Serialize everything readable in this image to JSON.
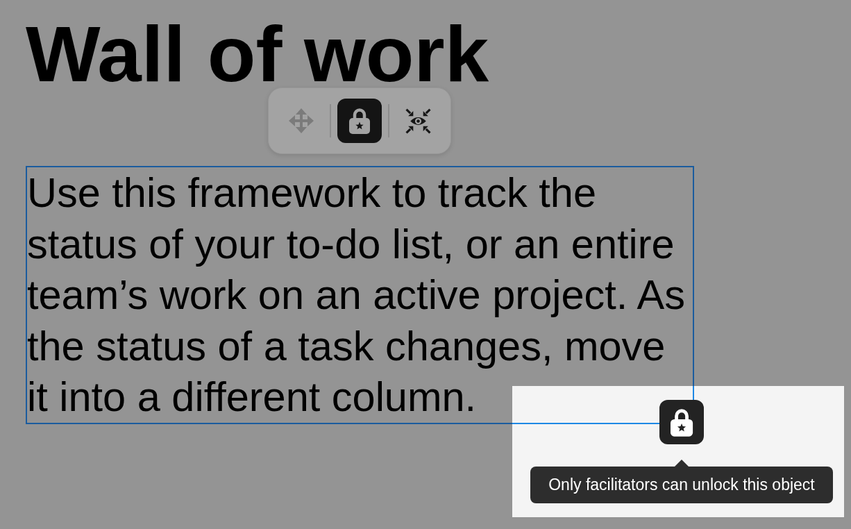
{
  "canvas": {
    "title": "Wall of work",
    "text_block": {
      "text": "Use this framework to track the status of your to-do list, or an entire team’s work on an active project. As the status of a task changes, move it into a different column.",
      "selected": true,
      "locked": true
    }
  },
  "toolbar": {
    "tools": [
      {
        "kind": "move",
        "disabled": true,
        "selected": false
      },
      {
        "kind": "lock",
        "disabled": false,
        "selected": true
      },
      {
        "kind": "focus",
        "disabled": false,
        "selected": false
      }
    ]
  },
  "lock_indicator": {
    "tooltip": "Only facilitators can unlock this object"
  }
}
